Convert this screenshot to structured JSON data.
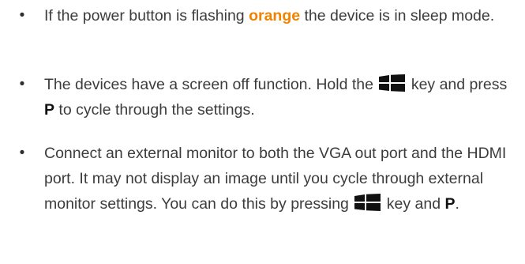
{
  "colors": {
    "text": "#3c3c3c",
    "orange": "#f08300",
    "icon": "#111111"
  },
  "icons": {
    "bullet": "bullet-dot",
    "windows_key": "windows-key-icon"
  },
  "items": [
    {
      "bullet": "•",
      "pre": "If the power button is flashing ",
      "highlight": "orange",
      "post": " the device is in sleep mode."
    },
    {
      "bullet": "•",
      "pre": "The devices have a screen off function. Hold the ",
      "post1": " key and press ",
      "key": "P",
      "post2": " to cycle through the settings."
    },
    {
      "bullet": "•",
      "pre": "Connect an external monitor to both the VGA out port and the HDMI port. It may not display an image until you cycle through external monitor settings. You can do this by pressing ",
      "post1": " key and ",
      "key": "P",
      "post2": "."
    }
  ]
}
